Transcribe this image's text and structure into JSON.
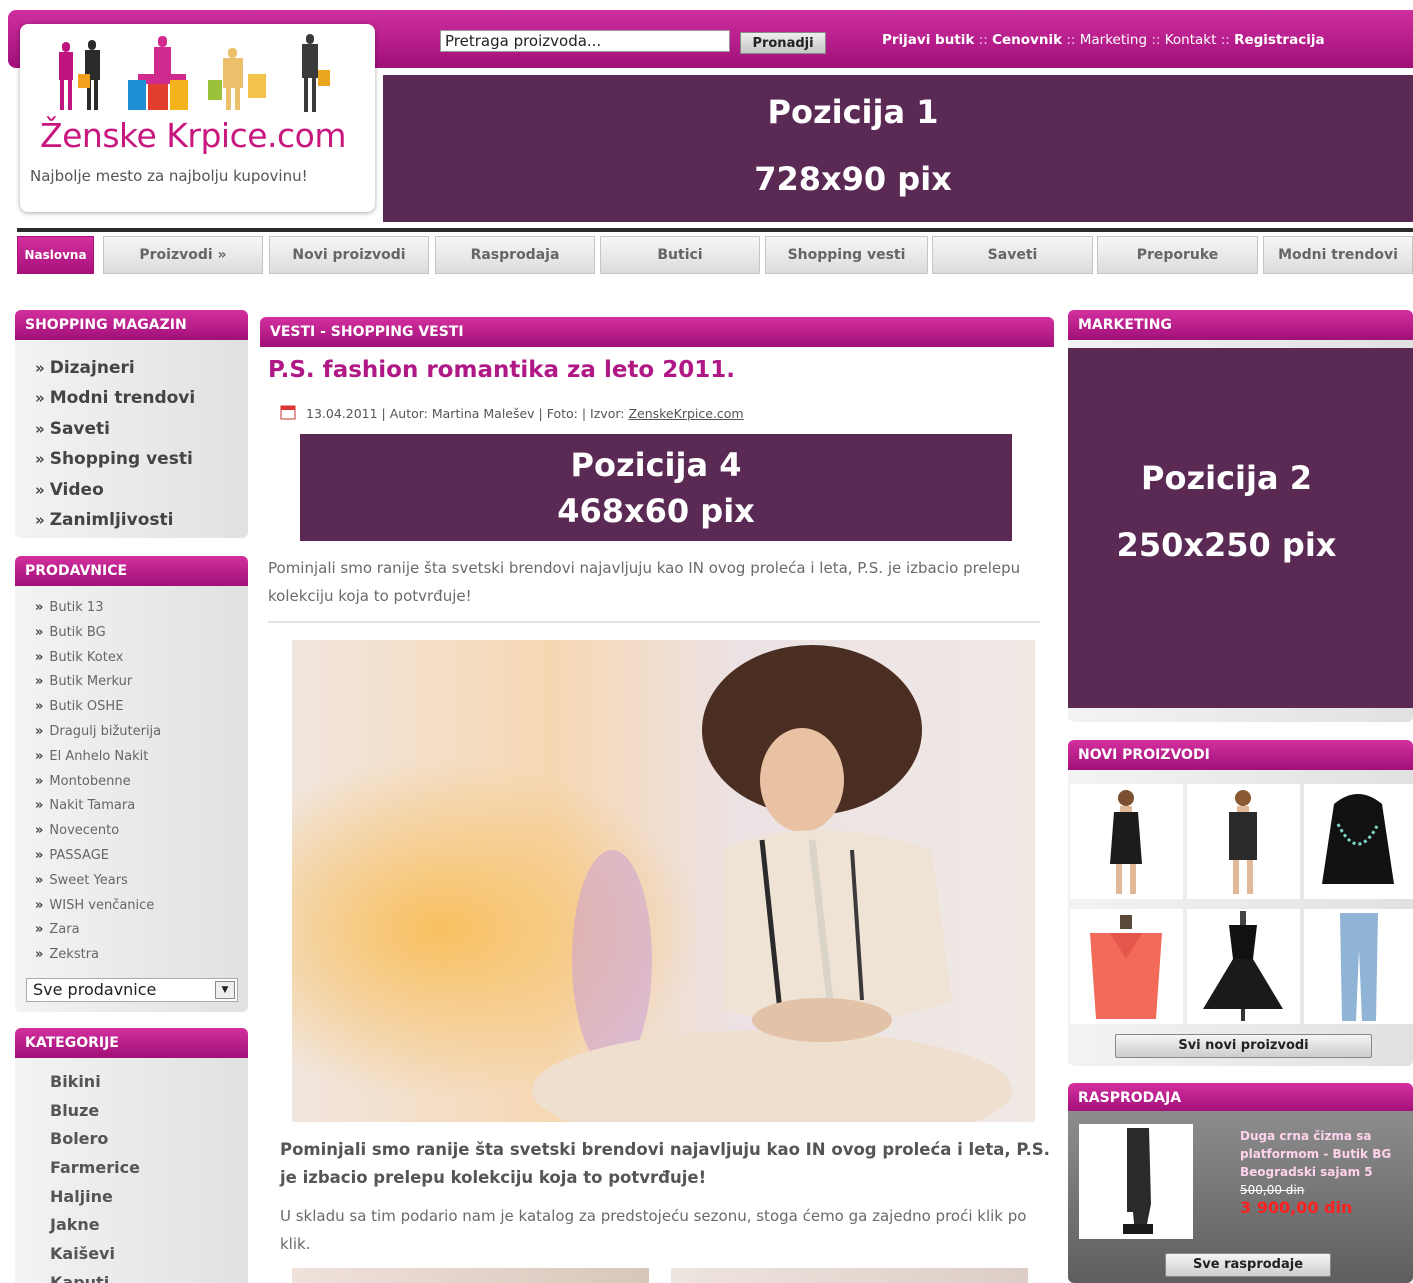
{
  "header": {
    "search_placeholder": "Pretraga proizvoda...",
    "search_button": "Pronadji",
    "links": {
      "login": "Prijavi butik",
      "pricing": "Cenovnik",
      "marketing": "Marketing",
      "contact": "Kontakt",
      "register": "Registracija",
      "sep": " :: "
    },
    "logo_title": "Ženske Krpice.com",
    "logo_subtitle": "Najbolje mesto za najbolju kupovinu!",
    "ad1_line1": "Pozicija 1",
    "ad1_line2": "728x90 pix"
  },
  "nav": {
    "items": [
      "Naslovna",
      "Proizvodi »",
      "Novi proizvodi",
      "Rasprodaja",
      "Butici",
      "Shopping vesti",
      "Saveti",
      "Preporuke",
      "Modni trendovi"
    ],
    "active": "Naslovna"
  },
  "sidebar": {
    "magazine_title": "SHOPPING MAGAZIN",
    "magazine_items": [
      "Dizajneri",
      "Modni trendovi",
      "Saveti",
      "Shopping vesti",
      "Video",
      "Zanimljivosti"
    ],
    "shops_title": "PRODAVNICE",
    "shops": [
      "Butik 13",
      "Butik BG",
      "Butik Kotex",
      "Butik Merkur",
      "Butik OSHE",
      "Dragulj bižuterija",
      "El Anhelo Nakit",
      "Montobenne",
      "Nakit Tamara",
      "Novecento",
      "PASSAGE",
      "Sweet Years",
      "WISH venčanice",
      "Zara",
      "Zekstra"
    ],
    "shops_select": "Sve prodavnice",
    "categories_title": "KATEGORIJE",
    "categories": [
      "Bikini",
      "Bluze",
      "Bolero",
      "Farmerice",
      "Haljine",
      "Jakne",
      "Kaiševi",
      "Kaputi"
    ],
    "arrow": "»"
  },
  "article": {
    "section_title": "VESTI - SHOPPING VESTI",
    "title": "P.S. fashion romantika za leto 2011.",
    "meta": "13.04.2011 | Autor: Martina Malešev | Foto: | Izvor: ",
    "source_link": "ZenskeKrpice.com",
    "ad4_line1": "Pozicija 4",
    "ad4_line2": "468x60 pix",
    "intro": "Pominjali smo ranije šta svetski brendovi najavljuju kao IN ovog proleća i leta, P.S. je izbacio prelepu kolekciju koja to potvrđuje!",
    "lead": "Pominjali smo ranije šta svetski brendovi najavljuju kao IN ovog proleća i leta, P.S. je izbacio prelepu kolekciju koja to potvrđuje!",
    "body": "U skladu sa tim podario nam je katalog za predstojeću sezonu, stoga ćemo ga zajedno proći klik po klik."
  },
  "right": {
    "marketing_title": "MARKETING",
    "ad2_line1": "Pozicija 2",
    "ad2_line2": "250x250 pix",
    "new_products_title": "NOVI PROIZVODI",
    "all_new_button": "Svi novi proizvodi",
    "sale_title": "RASPRODAJA",
    "sale_desc": "Duga crna čizma sa platformom - Butik BG Beogradski sajam 5",
    "sale_old_price": "500,00 din",
    "sale_new_price": "3 900,00 din",
    "all_sale_button": "Sve rasprodaje"
  },
  "colors": {
    "brand_magenta": "#b01886",
    "ad_purple": "#5a2a55",
    "sale_price": "#ff2020"
  }
}
